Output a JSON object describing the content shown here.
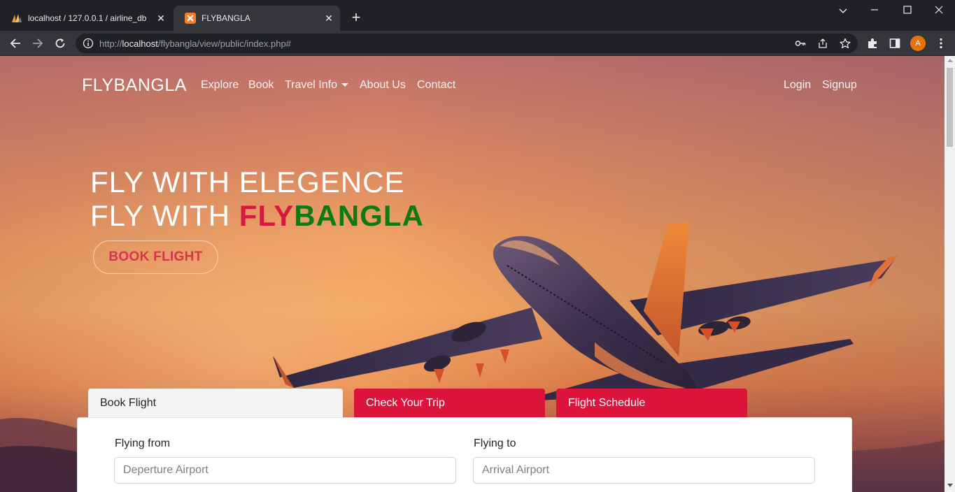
{
  "browser": {
    "tabs": [
      {
        "title": "localhost / 127.0.0.1 / airline_db / ",
        "icon": "phpmyadmin-icon",
        "active": false
      },
      {
        "title": "FLYBANGLA",
        "icon": "xampp-icon",
        "active": true
      }
    ],
    "url_prefix": "http://",
    "url_host": "localhost",
    "url_path": "/flybangla/view/public/index.php#",
    "profile_initial": "A"
  },
  "site": {
    "brand": "FLYBANGLA",
    "nav": {
      "explore": "Explore",
      "book": "Book",
      "travel_info": "Travel Info",
      "about": "About Us",
      "contact": "Contact",
      "login": "Login",
      "signup": "Signup"
    },
    "hero": {
      "line1": "FLY WITH ELEGENCE",
      "line2_prefix": "FLY WITH ",
      "line2_red": "FLY",
      "line2_green": "BANGLA",
      "cta": "BOOK FLIGHT"
    },
    "tabs": {
      "book_flight": "Book Flight",
      "check_trip": "Check Your Trip",
      "schedule": "Flight Schedule"
    },
    "form": {
      "from_label": "Flying from",
      "from_placeholder": "Deperture Airport",
      "from_value": "",
      "to_label": "Flying to",
      "to_placeholder": "Arrival Airport",
      "to_value": ""
    }
  },
  "colors": {
    "accent_red": "#dc143c",
    "brand_green": "#0d7a16",
    "cta_red": "#d9344e"
  }
}
